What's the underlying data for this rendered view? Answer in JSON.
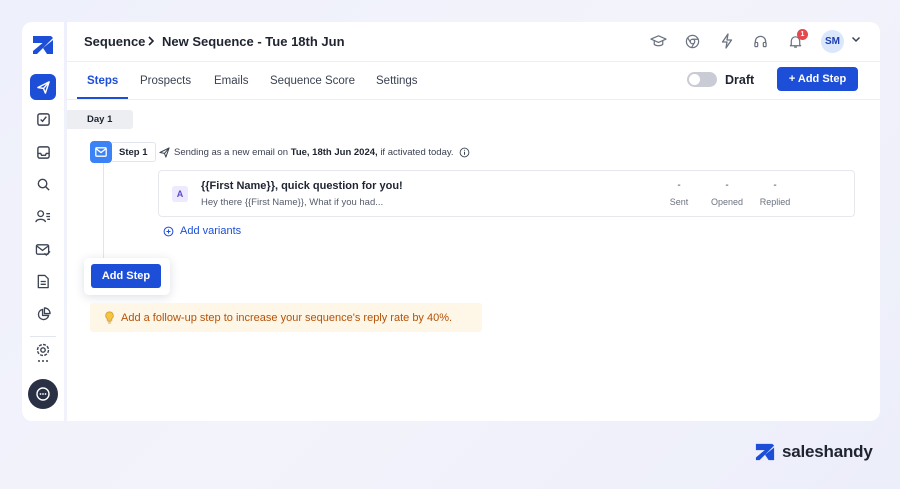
{
  "app": {
    "brand_name": "saleshandy",
    "accent_color": "#1d4ed8"
  },
  "sidebar": {
    "items": [
      {
        "icon": "send-icon",
        "active": true
      },
      {
        "icon": "task-check-icon",
        "active": false
      },
      {
        "icon": "inbox-icon",
        "active": false
      },
      {
        "icon": "search-icon",
        "active": false
      },
      {
        "icon": "prospects-icon",
        "active": false
      },
      {
        "icon": "mail-check-icon",
        "active": false
      },
      {
        "icon": "document-icon",
        "active": false
      },
      {
        "icon": "pie-chart-icon",
        "active": false
      },
      {
        "icon": "settings-icon",
        "active": false
      }
    ],
    "chat_icon": "chat-icon"
  },
  "header": {
    "breadcrumb_root": "Sequence",
    "title": "New Sequence - Tue 18th Jun",
    "notification_count": "1",
    "avatar_initials": "SM",
    "icons": [
      "graduation-cap-icon",
      "chrome-icon",
      "bolt-icon",
      "headset-icon",
      "bell-icon"
    ]
  },
  "tabs": {
    "items": [
      "Steps",
      "Prospects",
      "Emails",
      "Sequence Score",
      "Settings"
    ],
    "active": "Steps",
    "status_label": "Draft",
    "add_step_label": "+ Add Step"
  },
  "steps": {
    "day_label": "Day 1",
    "step_label": "Step 1",
    "send_info_prefix": "Sending as a new email on",
    "send_info_date": "Tue, 18th Jun 2024,",
    "send_info_suffix": "if activated today.",
    "email": {
      "variant": "A",
      "subject": "{{First Name}}, quick question for you!",
      "preview": "Hey there {{First Name}},   What if you had...",
      "stats": [
        {
          "label": "Sent",
          "value": "-"
        },
        {
          "label": "Opened",
          "value": "-"
        },
        {
          "label": "Replied",
          "value": "-"
        }
      ]
    },
    "add_variants_label": "Add variants",
    "add_step_label": "Add Step",
    "tip_text": "Add a follow-up step to increase your sequence's reply rate by 40%."
  }
}
